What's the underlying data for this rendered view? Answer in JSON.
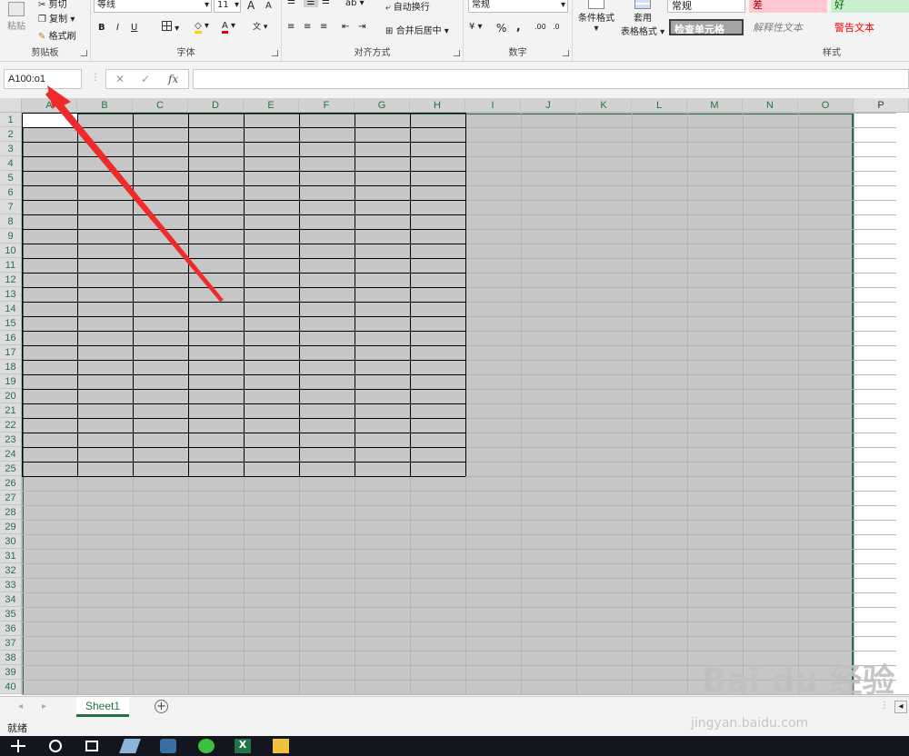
{
  "ribbon": {
    "clipboard": {
      "paste": "粘贴",
      "cut": "剪切",
      "copy": "复制",
      "format_painter": "格式刷",
      "label": "剪贴板"
    },
    "font": {
      "name": "等线",
      "size": "11",
      "grow": "A",
      "shrink": "A",
      "bold": "B",
      "italic": "I",
      "underline": "U",
      "label": "字体"
    },
    "alignment": {
      "wrap": "自动换行",
      "merge": "合并后居中",
      "label": "对齐方式"
    },
    "number": {
      "format": "常规",
      "percent": "%",
      "comma": ",",
      "inc_decimal": ".00",
      "dec_decimal": ".0",
      "label": "数字"
    },
    "styles": {
      "conditional": "条件格式",
      "table_format_1": "套用",
      "table_format_2": "表格格式",
      "normal": "常规",
      "bad": "差",
      "good": "好",
      "check_cell": "检查单元格",
      "explanatory": "解释性文本",
      "warning": "警告文本",
      "label": "样式"
    }
  },
  "formula_bar": {
    "name_box": "A100:o1",
    "cancel": "✕",
    "enter": "✓",
    "fx": "fx",
    "formula": ""
  },
  "grid": {
    "columns": [
      "A",
      "B",
      "C",
      "D",
      "E",
      "F",
      "G",
      "H",
      "I",
      "J",
      "K",
      "L",
      "M",
      "N",
      "O",
      "P"
    ],
    "rows": [
      "1",
      "2",
      "3",
      "4",
      "5",
      "6",
      "7",
      "8",
      "9",
      "10",
      "11",
      "12",
      "13",
      "14",
      "15",
      "16",
      "17",
      "18",
      "19",
      "20",
      "21",
      "22",
      "23",
      "24",
      "25",
      "26",
      "27",
      "28",
      "29",
      "30",
      "31",
      "32",
      "33",
      "34",
      "35",
      "36",
      "37",
      "38",
      "39",
      "40"
    ]
  },
  "sheets": {
    "active": "Sheet1",
    "add": "+"
  },
  "status": {
    "ready": "就绪"
  },
  "watermark": {
    "brand": "Bai du 经验",
    "url": "jingyan.baidu.com"
  },
  "colors": {
    "accent": "#217346",
    "selection": "#c6c6c6",
    "arrow": "#ee2a2a"
  }
}
